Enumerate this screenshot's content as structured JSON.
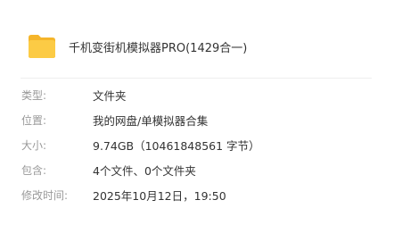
{
  "header": {
    "icon": "folder-icon",
    "icon_color": "#F9C53C",
    "title": "千机变街机模拟器PRO(1429合一)"
  },
  "properties": [
    {
      "label": "类型:",
      "value": "文件夹"
    },
    {
      "label": "位置:",
      "value": "我的网盘/单模拟器合集"
    },
    {
      "label": "大小:",
      "value": "9.74GB（10461848561 字节）"
    },
    {
      "label": "包含:",
      "value": "4个文件、0个文件夹"
    },
    {
      "label": "修改时间:",
      "value": "2025年10月12日，19:50"
    }
  ]
}
